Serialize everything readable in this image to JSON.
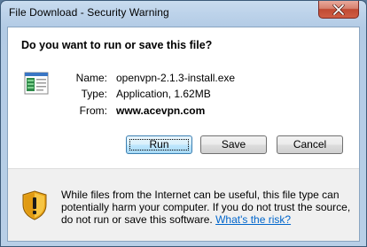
{
  "window": {
    "title": "File Download - Security Warning",
    "close_icon": "close-icon"
  },
  "dialog": {
    "question": "Do you want to run or save this file?",
    "file": {
      "icon": "executable-file-icon",
      "name_label": "Name:",
      "name_value": "openvpn-2.1.3-install.exe",
      "type_label": "Type:",
      "type_value": "Application, 1.62MB",
      "from_label": "From:",
      "from_value": "www.acevpn.com"
    },
    "buttons": {
      "run": "Run",
      "save": "Save",
      "cancel": "Cancel"
    },
    "warning": {
      "icon": "security-shield-icon",
      "text": "While files from the Internet can be useful, this file type can potentially harm your computer. If you do not trust the source, do not run or save this software. ",
      "link": "What's the risk?"
    }
  },
  "colors": {
    "title_bar": "#bdd3ea",
    "close_button": "#c9533c",
    "link": "#0066cc",
    "default_button_border": "#3c7fb1"
  }
}
